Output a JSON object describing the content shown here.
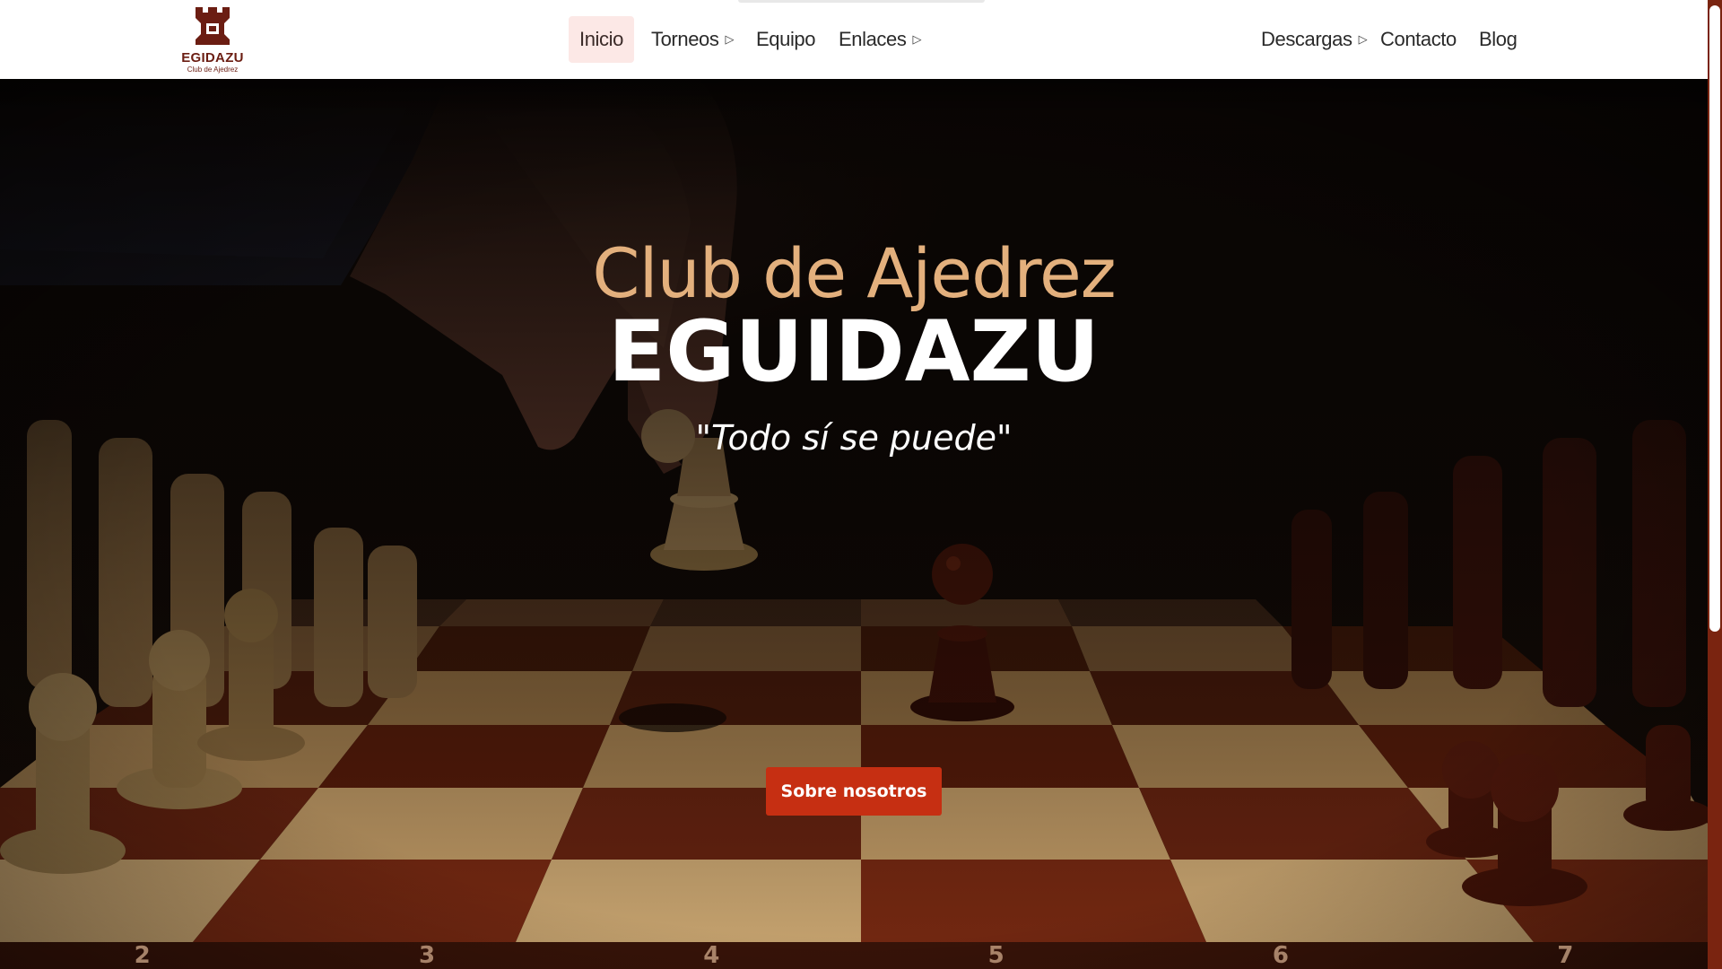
{
  "brand": {
    "logo_title": "EGIDAZU",
    "logo_subtitle": "Club de Ajedrez",
    "primary_color": "#6b1d12",
    "accent_color": "#c62f12",
    "title_color": "#e3b07d"
  },
  "nav": {
    "items": [
      {
        "label": "Inicio",
        "active": true
      },
      {
        "label": "Torneos",
        "has_submenu": true
      },
      {
        "label": "Equipo"
      },
      {
        "label": "Enlaces",
        "has_submenu": true
      },
      {
        "label": "Descargas",
        "has_submenu": true
      },
      {
        "label": "Contacto"
      },
      {
        "label": "Blog"
      }
    ],
    "caret_glyph": "▷"
  },
  "hero": {
    "title_line1": "Club de Ajedrez",
    "title_line2": "EGUIDAZU",
    "tagline": "\"Todo sí se puede\"",
    "cta_label": "Sobre nosotros",
    "board_numbers": [
      "2",
      "3",
      "4",
      "5",
      "6",
      "7"
    ]
  },
  "icons": {
    "logo": "rook-crown-icon",
    "submenu": "triangle-right-icon"
  }
}
